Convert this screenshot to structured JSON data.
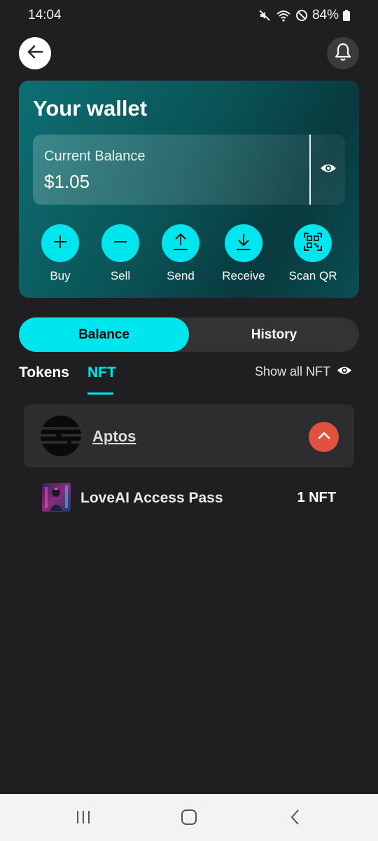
{
  "status_bar": {
    "time": "14:04",
    "battery": "84%",
    "icons": [
      "mute-icon",
      "wifi-icon",
      "dnd-icon",
      "battery-icon"
    ]
  },
  "header": {
    "back_icon": "arrow-left-icon",
    "notification_icon": "bell-icon"
  },
  "wallet": {
    "title": "Your wallet",
    "balance_label": "Current Balance",
    "balance_value": "$1.05",
    "toggle_icon": "eye-icon",
    "actions": [
      {
        "label": "Buy",
        "icon": "plus-icon"
      },
      {
        "label": "Sell",
        "icon": "minus-icon"
      },
      {
        "label": "Send",
        "icon": "upload-icon"
      },
      {
        "label": "Receive",
        "icon": "download-icon"
      },
      {
        "label": "Scan QR",
        "icon": "qr-scan-icon"
      }
    ]
  },
  "segmented": {
    "tabs": [
      {
        "label": "Balance",
        "active": true
      },
      {
        "label": "History",
        "active": false
      }
    ]
  },
  "subtabs": {
    "items": [
      {
        "label": "Tokens",
        "active": false
      },
      {
        "label": "NFT",
        "active": true
      }
    ],
    "show_all_label": "Show all NFT"
  },
  "collections": [
    {
      "name": "Aptos",
      "expanded": true,
      "items": [
        {
          "name": "LoveAI Access Pass",
          "count": "1 NFT"
        }
      ]
    }
  ],
  "colors": {
    "accent": "#00e5ee",
    "background": "#1f1f21",
    "card_teal": "#0a5457",
    "collapse_red": "#e2503f"
  }
}
